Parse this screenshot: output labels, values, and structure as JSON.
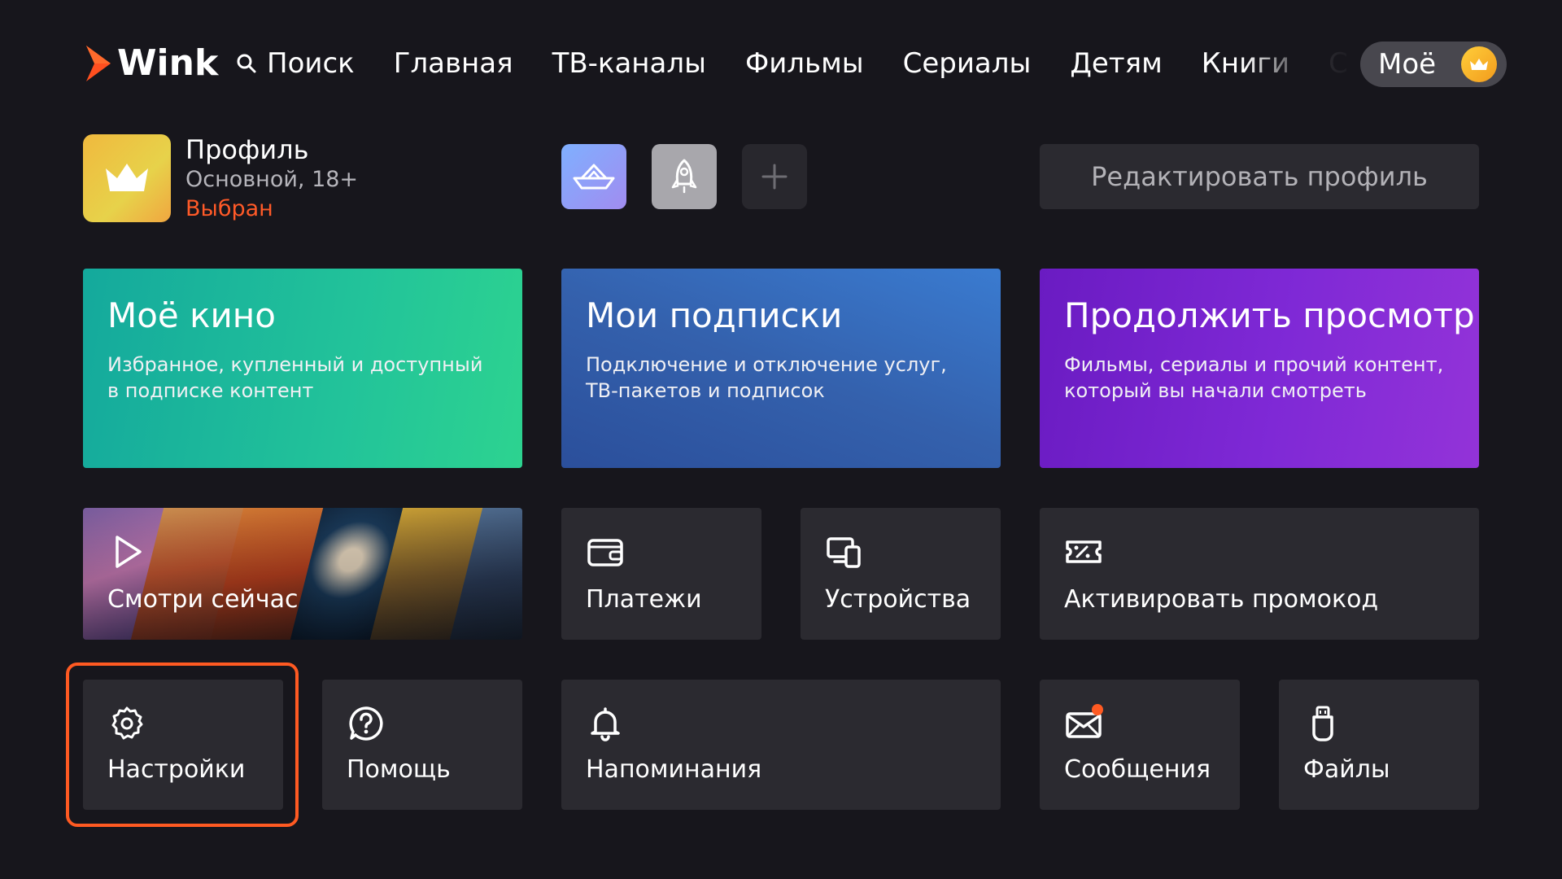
{
  "app": {
    "name": "Wink",
    "brand_color": "#ff5a22"
  },
  "nav": {
    "items": [
      {
        "label": "Поиск",
        "icon": "search-icon"
      },
      {
        "label": "Главная"
      },
      {
        "label": "ТВ-каналы"
      },
      {
        "label": "Фильмы"
      },
      {
        "label": "Сериалы"
      },
      {
        "label": "Детям"
      },
      {
        "label": "Книги"
      },
      {
        "label": "Спорт"
      }
    ],
    "active": {
      "label": "Моё",
      "icon": "crown-icon"
    }
  },
  "profile": {
    "name": "Профиль",
    "subtitle": "Основной, 18+",
    "status": "Выбран",
    "avatar_icon": "crown-icon",
    "others": [
      {
        "icon": "paper-boat-icon"
      },
      {
        "icon": "rocket-icon"
      },
      {
        "icon": "plus-icon"
      }
    ],
    "edit_label": "Редактировать профиль"
  },
  "cards": {
    "kino": {
      "title": "Моё кино",
      "desc": "Избранное, купленный и доступный в подписке контент"
    },
    "subs": {
      "title": "Мои подписки",
      "desc": "Подключение и отключение услуг, ТВ-пакетов и подписок"
    },
    "cont": {
      "title": "Продолжить просмотр",
      "desc": "Фильмы, сериалы и прочий контент, который вы начали смотреть"
    }
  },
  "tiles": {
    "watch": {
      "label": "Смотри сейчас",
      "icon": "play-icon"
    },
    "payments": {
      "label": "Платежи",
      "icon": "wallet-icon"
    },
    "devices": {
      "label": "Устройства",
      "icon": "devices-icon"
    },
    "promo": {
      "label": "Активировать промокод",
      "icon": "promo-ticket-icon"
    },
    "settings": {
      "label": "Настройки",
      "icon": "gear-icon",
      "focused": true
    },
    "help": {
      "label": "Помощь",
      "icon": "help-icon"
    },
    "reminders": {
      "label": "Напоминания",
      "icon": "bell-icon"
    },
    "messages": {
      "label": "Сообщения",
      "icon": "mail-icon",
      "has_unread": true
    },
    "files": {
      "label": "Файлы",
      "icon": "usb-icon"
    }
  }
}
